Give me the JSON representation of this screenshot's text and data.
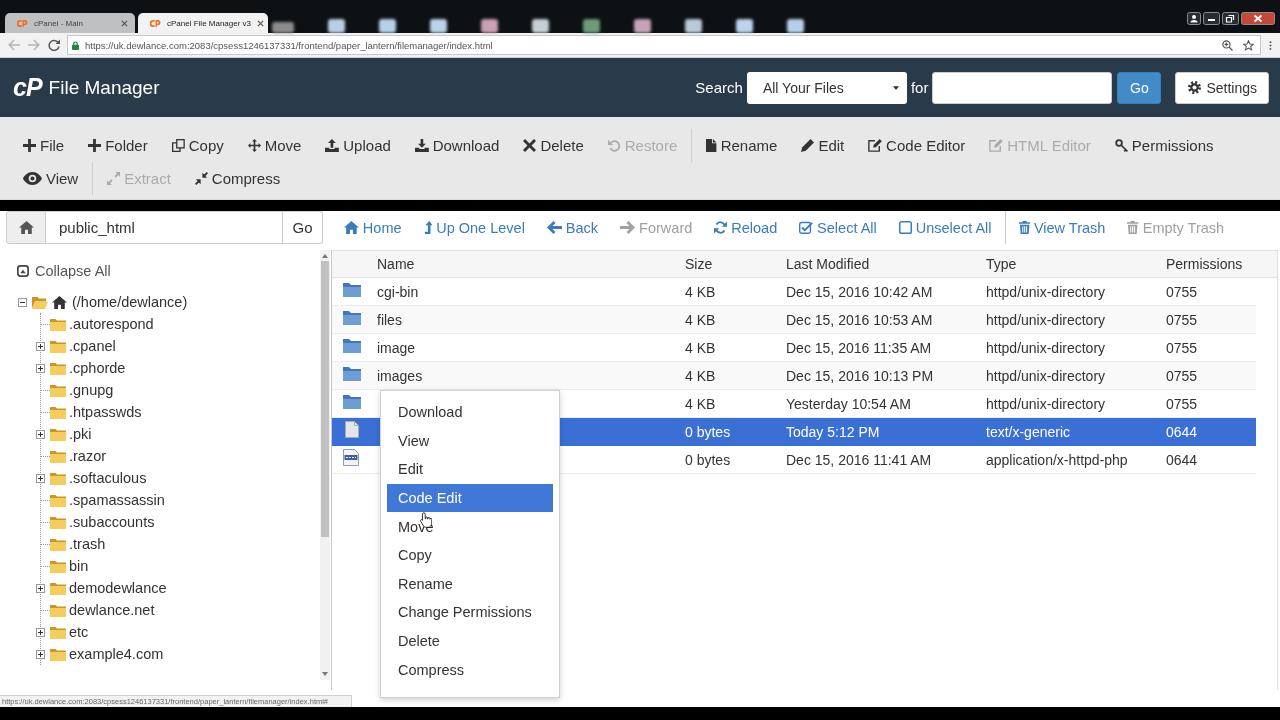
{
  "browser": {
    "tabs": [
      {
        "title": "cPanel - Main",
        "selected": false
      },
      {
        "title": "cPanel File Manager v3",
        "selected": true
      }
    ],
    "url": "https://uk.dewlance.com:2083/cpsess1246137331/frontend/paper_lantern/filemanager/index.html",
    "status_url": "https://uk.dewlance.com:2083/cpsess1246137331/frontend/paper_lantern/filemanager/index.html#"
  },
  "header": {
    "logo": "cP",
    "title": "File Manager",
    "search_label": "Search",
    "search_scope": "All Your Files",
    "for_label": "for",
    "go_button": "Go",
    "settings_button": "Settings"
  },
  "toolbar": {
    "rows": [
      {
        "groups": [
          {
            "buttons": [
              {
                "label": "File",
                "disabled": false
              },
              {
                "label": "Folder",
                "disabled": false
              },
              {
                "label": "Copy",
                "disabled": false
              },
              {
                "label": "Move",
                "disabled": false
              },
              {
                "label": "Upload",
                "disabled": false
              },
              {
                "label": "Download",
                "disabled": false
              },
              {
                "label": "Delete",
                "disabled": false
              },
              {
                "label": "Restore",
                "disabled": true
              }
            ]
          },
          {
            "buttons": [
              {
                "label": "Rename",
                "disabled": false
              },
              {
                "label": "Edit",
                "disabled": false
              },
              {
                "label": "Code Editor",
                "disabled": false
              },
              {
                "label": "HTML Editor",
                "disabled": true
              },
              {
                "label": "Permissions",
                "disabled": false
              }
            ]
          }
        ]
      },
      {
        "groups": [
          {
            "buttons": [
              {
                "label": "View",
                "disabled": false
              }
            ]
          },
          {
            "buttons": [
              {
                "label": "Extract",
                "disabled": true
              },
              {
                "label": "Compress",
                "disabled": false
              }
            ]
          }
        ]
      }
    ]
  },
  "path_bar": {
    "value": "public_html",
    "go_button": "Go"
  },
  "nav": {
    "groups": [
      {
        "links": [
          {
            "label": "Home",
            "disabled": false
          },
          {
            "label": "Up One Level",
            "disabled": false
          },
          {
            "label": "Back",
            "disabled": false
          },
          {
            "label": "Forward",
            "disabled": true
          },
          {
            "label": "Reload",
            "disabled": false
          },
          {
            "label": "Select All",
            "disabled": false
          },
          {
            "label": "Unselect All",
            "disabled": false
          }
        ]
      },
      {
        "links": [
          {
            "label": "View Trash",
            "disabled": false
          },
          {
            "label": "Empty Trash",
            "disabled": true
          }
        ]
      }
    ]
  },
  "tree": {
    "collapse_all": "Collapse All",
    "root": {
      "label": "(/home/dewlance)",
      "expandable": true,
      "expanded": true,
      "children": [
        {
          "label": ".autorespond",
          "expandable": false
        },
        {
          "label": ".cpanel",
          "expandable": true
        },
        {
          "label": ".cphorde",
          "expandable": true
        },
        {
          "label": ".gnupg",
          "expandable": false
        },
        {
          "label": ".htpasswds",
          "expandable": false
        },
        {
          "label": ".pki",
          "expandable": true
        },
        {
          "label": ".razor",
          "expandable": false
        },
        {
          "label": ".softaculous",
          "expandable": true
        },
        {
          "label": ".spamassassin",
          "expandable": false
        },
        {
          "label": ".subaccounts",
          "expandable": false
        },
        {
          "label": ".trash",
          "expandable": false
        },
        {
          "label": "bin",
          "expandable": false
        },
        {
          "label": "demodewlance",
          "expandable": true
        },
        {
          "label": "dewlance.net",
          "expandable": false
        },
        {
          "label": "etc",
          "expandable": true
        },
        {
          "label": "example4.com",
          "expandable": true
        }
      ]
    }
  },
  "table": {
    "columns": [
      "Name",
      "Size",
      "Last Modified",
      "Type",
      "Permissions"
    ],
    "rows": [
      {
        "kind": "folder",
        "name": "cgi-bin",
        "size": "4 KB",
        "modified": "Dec 15, 2016 10:42 AM",
        "type": "httpd/unix-directory",
        "permissions": "0755",
        "selected": false
      },
      {
        "kind": "folder",
        "name": "files",
        "size": "4 KB",
        "modified": "Dec 15, 2016 10:53 AM",
        "type": "httpd/unix-directory",
        "permissions": "0755",
        "selected": false
      },
      {
        "kind": "folder",
        "name": "image",
        "size": "4 KB",
        "modified": "Dec 15, 2016 11:35 AM",
        "type": "httpd/unix-directory",
        "permissions": "0755",
        "selected": false
      },
      {
        "kind": "folder",
        "name": "images",
        "size": "4 KB",
        "modified": "Dec 15, 2016 10:13 PM",
        "type": "httpd/unix-directory",
        "permissions": "0755",
        "selected": false
      },
      {
        "kind": "folder",
        "size": "4 KB",
        "modified": "Yesterday 10:54 AM",
        "type": "httpd/unix-directory",
        "permissions": "0755",
        "selected": false
      },
      {
        "kind": "file",
        "size": "0 bytes",
        "modified": "Today 5:12 PM",
        "type": "text/x-generic",
        "permissions": "0644",
        "selected": true
      },
      {
        "kind": "script",
        "size": "0 bytes",
        "modified": "Dec 15, 2016 11:41 AM",
        "type": "application/x-httpd-php",
        "permissions": "0644",
        "selected": false
      }
    ]
  },
  "context_menu": {
    "items": [
      {
        "label": "Download",
        "selected": false
      },
      {
        "label": "View",
        "selected": false
      },
      {
        "label": "Edit",
        "selected": false
      },
      {
        "label": "Code Edit",
        "selected": true
      },
      {
        "label": "Move",
        "selected": false
      },
      {
        "label": "Copy",
        "selected": false
      },
      {
        "label": "Rename",
        "selected": false
      },
      {
        "label": "Change Permissions",
        "selected": false
      },
      {
        "label": "Delete",
        "selected": false
      },
      {
        "label": "Compress",
        "selected": false
      }
    ]
  }
}
